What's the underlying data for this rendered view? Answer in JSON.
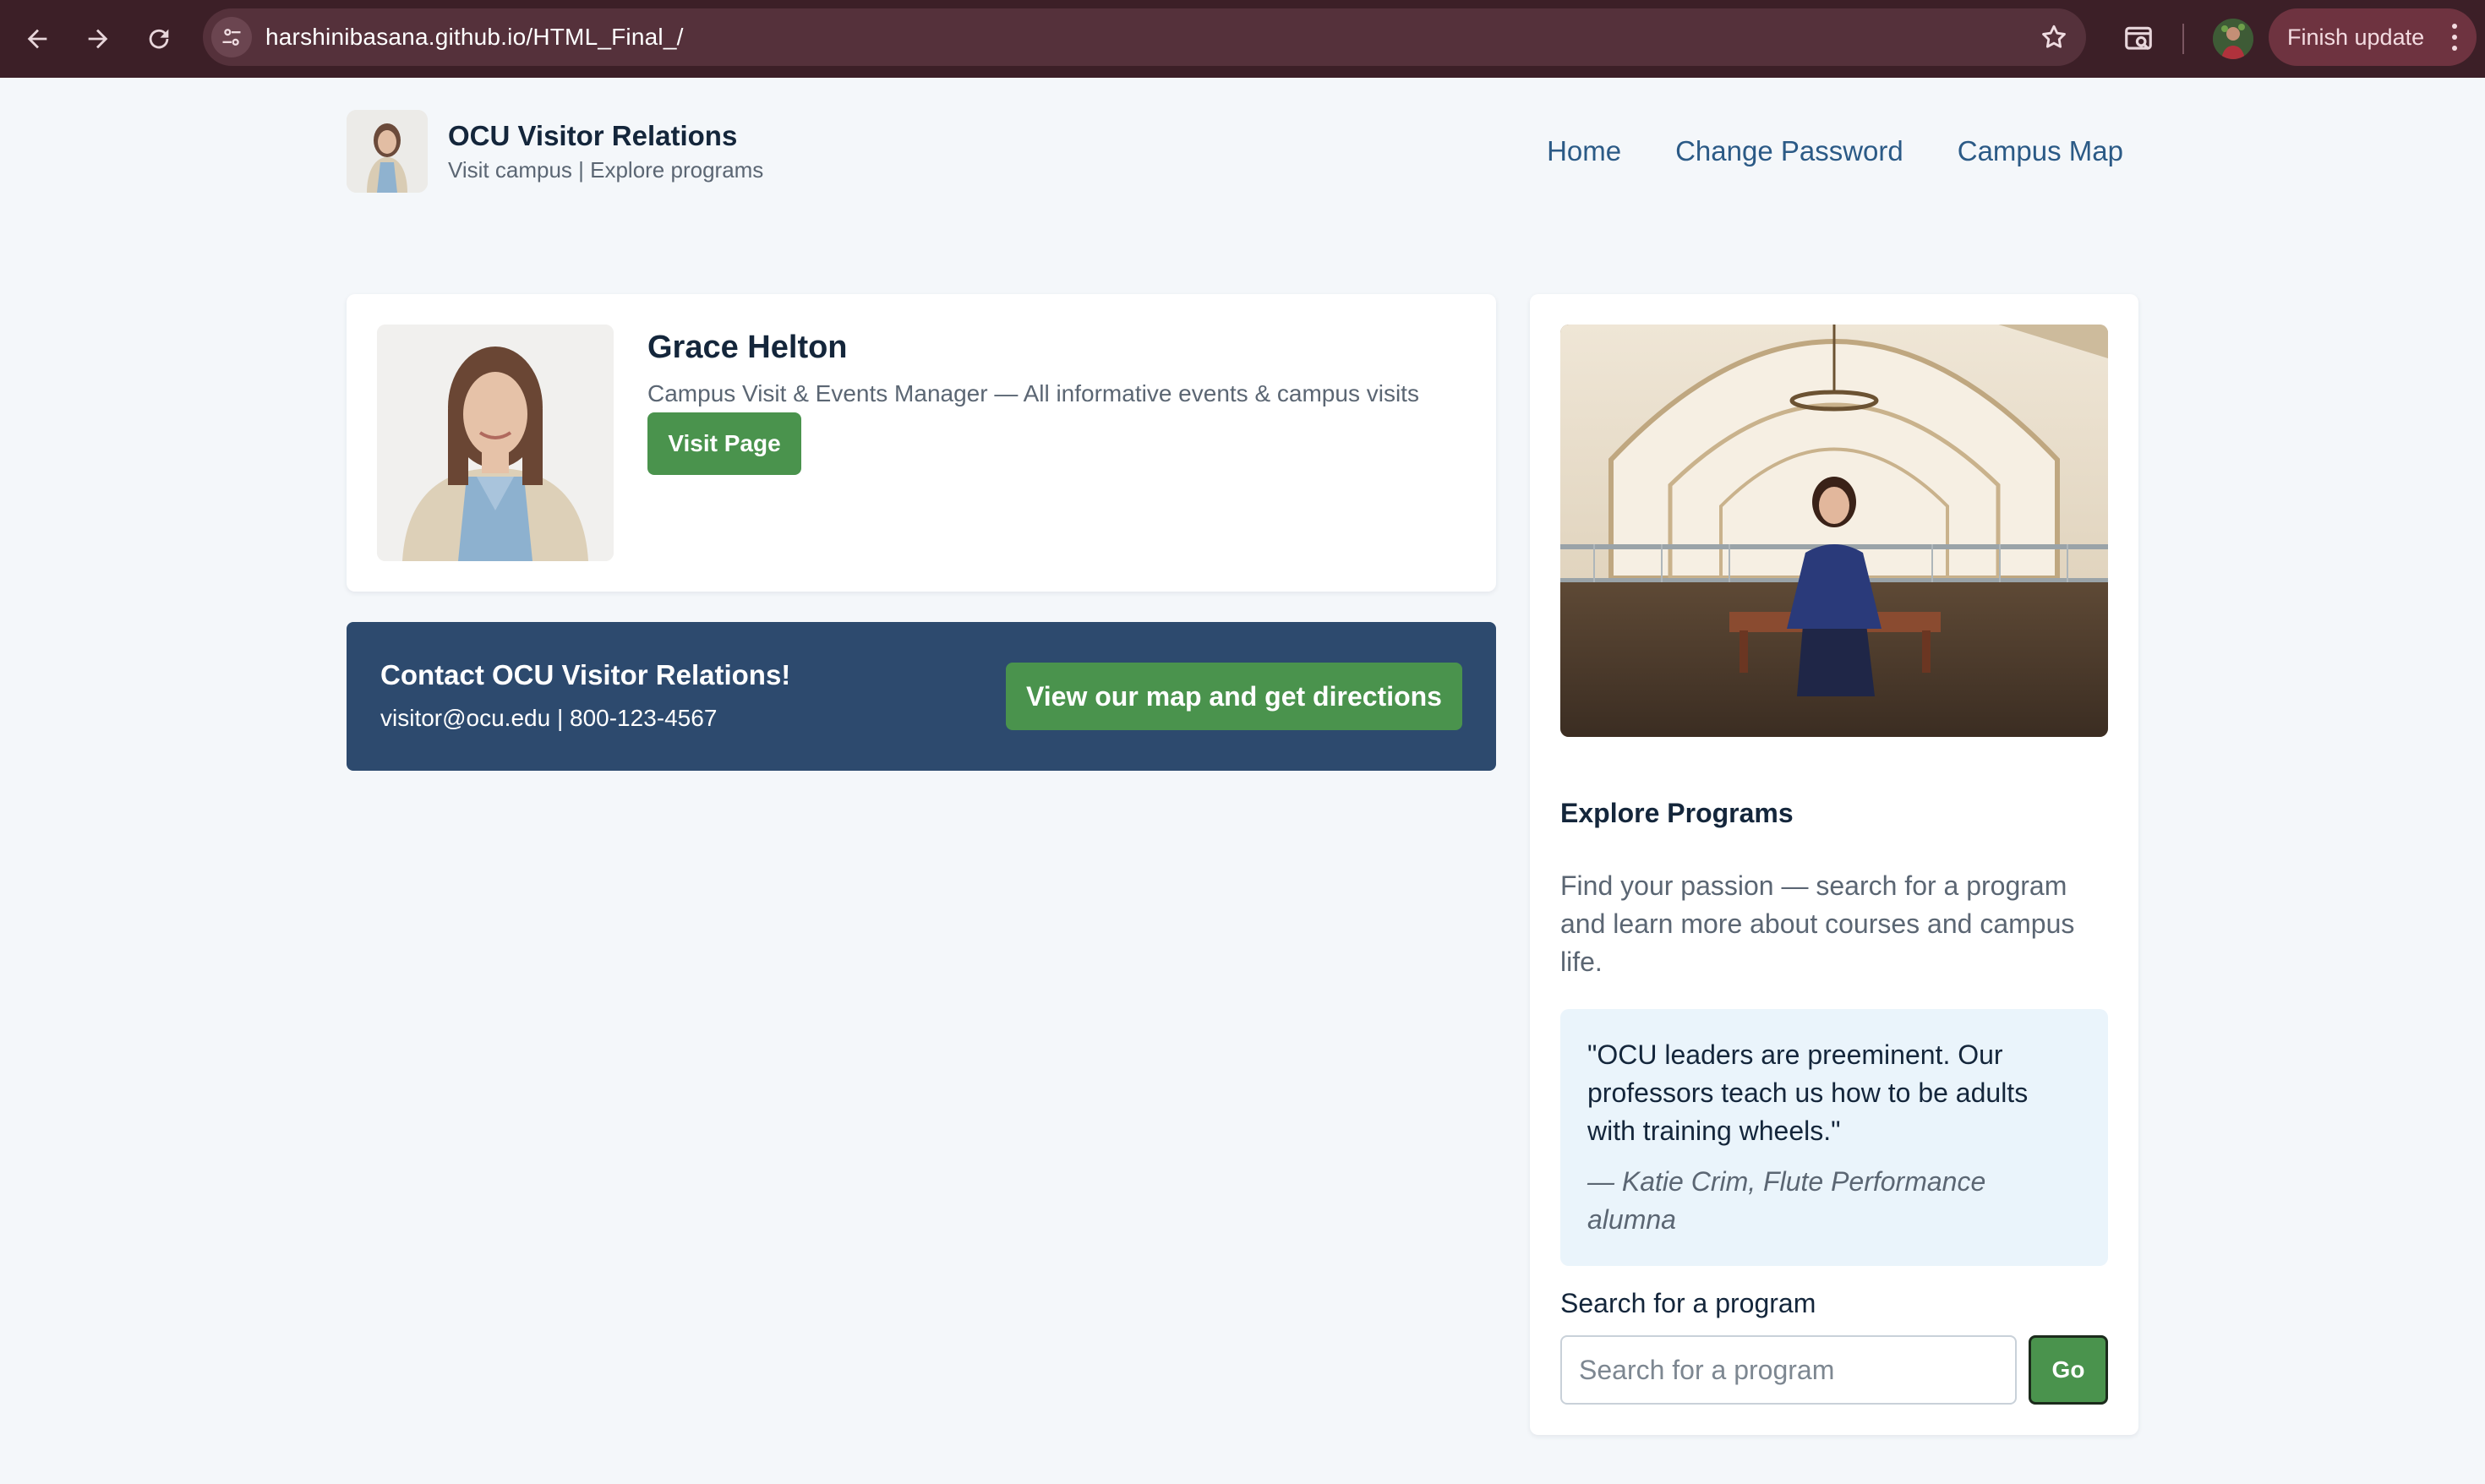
{
  "browser": {
    "url": "harshinibasana.github.io/HTML_Final_/",
    "update_label": "Finish update"
  },
  "header": {
    "brand_name": "OCU Visitor Relations",
    "tagline": "Visit campus | Explore programs",
    "nav": [
      {
        "label": "Home"
      },
      {
        "label": "Change Password"
      },
      {
        "label": "Campus Map"
      }
    ]
  },
  "profile": {
    "name": "Grace Helton",
    "role": "Campus Visit & Events Manager — All informative events & campus visits",
    "button_label": "Visit Page"
  },
  "contact": {
    "title": "Contact OCU Visitor Relations!",
    "info": "visitor@ocu.edu | 800-123-4567",
    "button_label": "View our map and get directions"
  },
  "explore": {
    "title": "Explore Programs",
    "description": "Find your passion — search for a program and learn more about courses and campus life.",
    "quote": "\"OCU leaders are preeminent. Our professors teach us how to be adults with training wheels.\"",
    "quote_author": "— Katie Crim, Flute Performance alumna",
    "search_label": "Search for a program",
    "search_placeholder": "Search for a program",
    "go_label": "Go"
  },
  "colors": {
    "accent_green": "#4a934d",
    "banner_blue": "#2d4a6e",
    "link_blue": "#2b5a86",
    "chrome_bg": "#3c1f27"
  }
}
